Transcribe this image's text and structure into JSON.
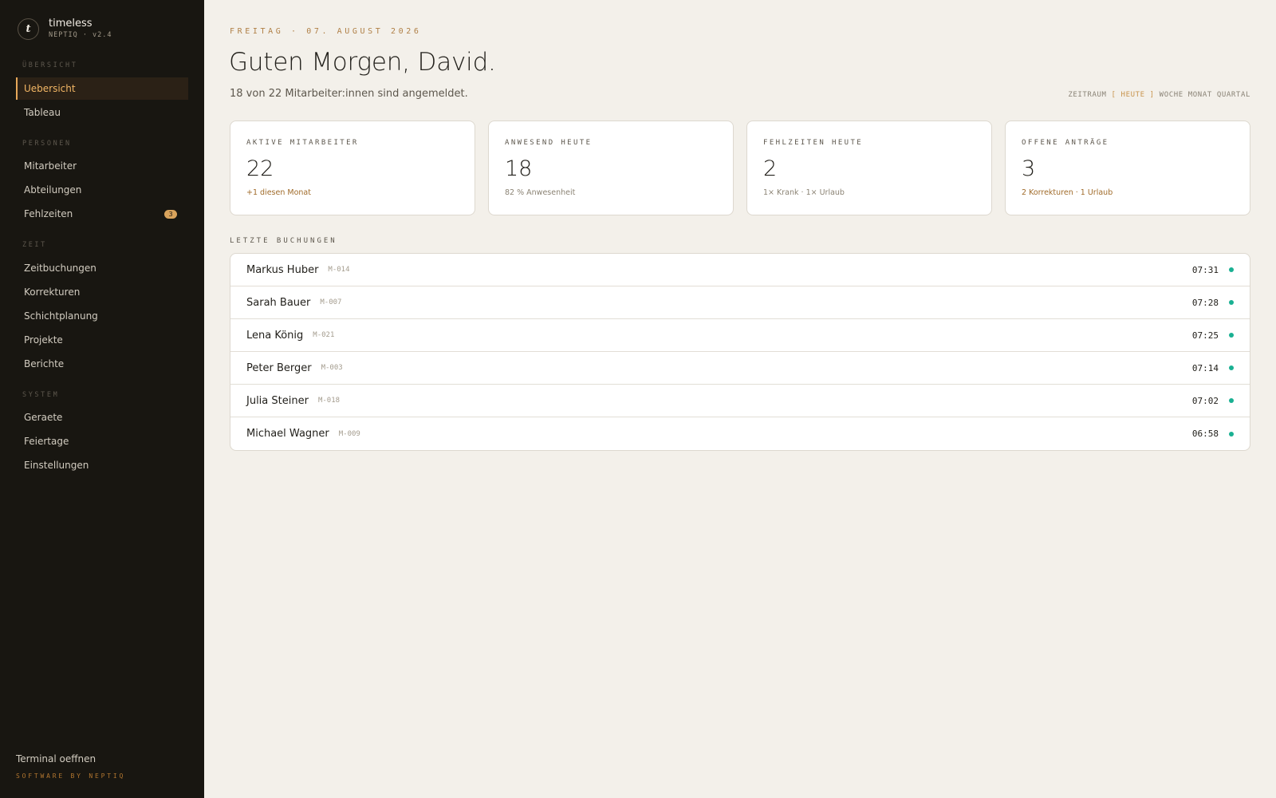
{
  "sidebar": {
    "brand": {
      "logo_letter": "t",
      "name": "timeless",
      "version": "NEPTIQ · v2.4"
    },
    "sections": {
      "overview": "ÜBERSICHT",
      "people": "PERSONEN",
      "time": "ZEIT",
      "system": "SYSTEM"
    },
    "items": {
      "uebersicht": "Uebersicht",
      "tableau": "Tableau",
      "mitarbeiter": "Mitarbeiter",
      "abteilungen": "Abteilungen",
      "fehlzeiten": "Fehlzeiten",
      "fehlzeiten_badge": "3",
      "zeitbuchungen": "Zeitbuchungen",
      "korrekturen": "Korrekturen",
      "schichtplanung": "Schichtplanung",
      "projekte": "Projekte",
      "berichte": "Berichte",
      "geraete": "Geraete",
      "feiertage": "Feiertage",
      "einstellungen": "Einstellungen"
    },
    "footer": {
      "terminal": "Terminal oeffnen",
      "credit": "SOFTWARE BY NEPTIQ"
    }
  },
  "header": {
    "date": "FREITAG · 07. AUGUST 2026",
    "greeting": "Guten Morgen, David.",
    "subtext": "18 von 22 Mitarbeiter:innen sind angemeldet."
  },
  "range": {
    "label": "ZEITRAUM",
    "open_bracket": "[",
    "active": "HEUTE",
    "close_bracket": "]",
    "options": [
      "WOCHE",
      "MONAT",
      "QUARTAL"
    ]
  },
  "cards": [
    {
      "label": "AKTIVE MITARBEITER",
      "value": "22",
      "note": "+1 diesen Monat"
    },
    {
      "label": "ANWESEND HEUTE",
      "value": "18",
      "note": "82 % Anwesenheit"
    },
    {
      "label": "FEHLZEITEN HEUTE",
      "value": "2",
      "note": "1× Krank · 1× Urlaub"
    },
    {
      "label": "OFFENE ANTRÄGE",
      "value": "3",
      "note": "2 Korrekturen · 1 Urlaub"
    }
  ],
  "bookings": {
    "title": "LETZTE BUCHUNGEN",
    "rows": [
      {
        "name": "Markus Huber",
        "id": "M-014",
        "time": "07:31"
      },
      {
        "name": "Sarah Bauer",
        "id": "M-007",
        "time": "07:28"
      },
      {
        "name": "Lena König",
        "id": "M-021",
        "time": "07:25"
      },
      {
        "name": "Peter Berger",
        "id": "M-003",
        "time": "07:14"
      },
      {
        "name": "Julia Steiner",
        "id": "M-018",
        "time": "07:02"
      },
      {
        "name": "Michael Wagner",
        "id": "M-009",
        "time": "06:58"
      }
    ]
  },
  "colors": {
    "accent": "#e7a85a",
    "sidebar_bg": "#181611",
    "page_bg": "#f3f0ea",
    "status_dot": "#19b092"
  }
}
